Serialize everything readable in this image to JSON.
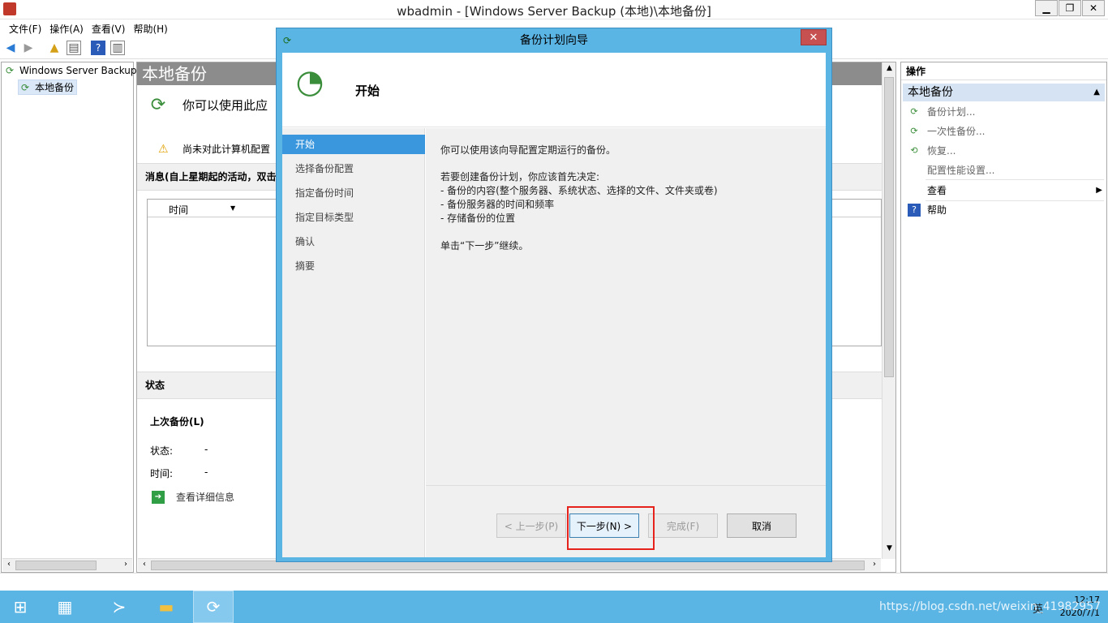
{
  "window": {
    "title": "wbadmin - [Windows Server Backup (本地)\\本地备份]"
  },
  "menu": [
    "文件(F)",
    "操作(A)",
    "查看(V)",
    "帮助(H)"
  ],
  "tree": {
    "root": "Windows Server Backup",
    "child": "本地备份"
  },
  "center": {
    "header": "本地备份",
    "intro": "你可以使用此应",
    "warning": "尚未对此计算机配置",
    "messages_title": "消息(自上星期起的活动，双击",
    "col_time": "时间",
    "status_title": "状态",
    "last_backup": "上次备份(L)",
    "status_label": "状态:",
    "status_value": "-",
    "time_label": "时间:",
    "time_value": "-",
    "details_link": "查看详细信息"
  },
  "actions": {
    "title": "操作",
    "group": "本地备份",
    "items": [
      "备份计划...",
      "一次性备份...",
      "恢复...",
      "配置性能设置...",
      "查看",
      "帮助"
    ]
  },
  "dialog": {
    "title": "备份计划向导",
    "heading": "开始",
    "steps": [
      "开始",
      "选择备份配置",
      "指定备份时间",
      "指定目标类型",
      "确认",
      "摘要"
    ],
    "paragraphs": [
      "你可以使用该向导配置定期运行的备份。",
      "若要创建备份计划，你应该首先决定:",
      "- 备份的内容(整个服务器、系统状态、选择的文件、文件夹或卷)",
      "- 备份服务器的时间和频率",
      "- 存储备份的位置",
      "单击“下一步”继续。"
    ],
    "buttons": {
      "prev": "< 上一步(P)",
      "next": "下一步(N) >",
      "finish": "完成(F)",
      "cancel": "取消"
    }
  },
  "taskbar": {
    "time": "12:17",
    "date": "2020/7/1",
    "ime": "英",
    "watermark": "https://blog.csdn.net/weixin_41982957"
  }
}
